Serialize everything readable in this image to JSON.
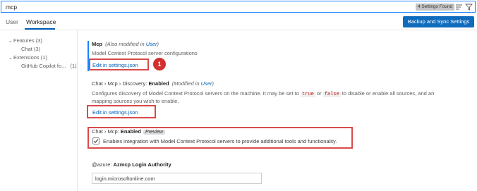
{
  "search": {
    "value": "mcp",
    "results_count": "4 Settings Found"
  },
  "tabs": [
    {
      "label": "User"
    },
    {
      "label": "Workspace"
    }
  ],
  "sync_button": {
    "label": "Backup and Sync Settings"
  },
  "toc": [
    {
      "label": "Features (3)"
    },
    {
      "label": "Chat (3)"
    },
    {
      "label": "Extensions (1)"
    },
    {
      "label": "GitHub Copilot fo...",
      "count": "(1)"
    }
  ],
  "settings": {
    "mcp": {
      "name": "Mcp",
      "modified_prefix": "(Also modified in ",
      "modified_link": "User",
      "modified_suffix": ")",
      "description": "Model Context Protocol server configurations",
      "edit_link": "Edit in settings.json"
    },
    "discovery": {
      "category": "Chat › Mcp › Discovery: ",
      "name": "Enabled",
      "modified_prefix": "(Modified in ",
      "modified_link": "User",
      "modified_suffix": ")",
      "desc_part1": "Configures discovery of Model Context Protocol servers on the machine. It may be set to ",
      "code_true": "true",
      "desc_or": " or ",
      "code_false": "false",
      "desc_part2": " to disable or enable all sources, and an",
      "desc_line2": "mapping sources you wish to enable.",
      "edit_link": "Edit in settings.json"
    },
    "enabled": {
      "category": "Chat › Mcp: ",
      "name": "Enabled",
      "tag": "Preview",
      "checkbox_label": "Enables integration with Model Context Protocol servers to provide additional tools and functionality.",
      "checked": true
    },
    "authority": {
      "category": "@azure: ",
      "name": "Azmcp Login Authority",
      "value": "login.microsoftonline.com"
    }
  },
  "annotation": {
    "step": "1"
  },
  "colors": {
    "accent": "#005fb8",
    "button": "#0f6cbd",
    "annotation_red": "#d32f2f"
  }
}
